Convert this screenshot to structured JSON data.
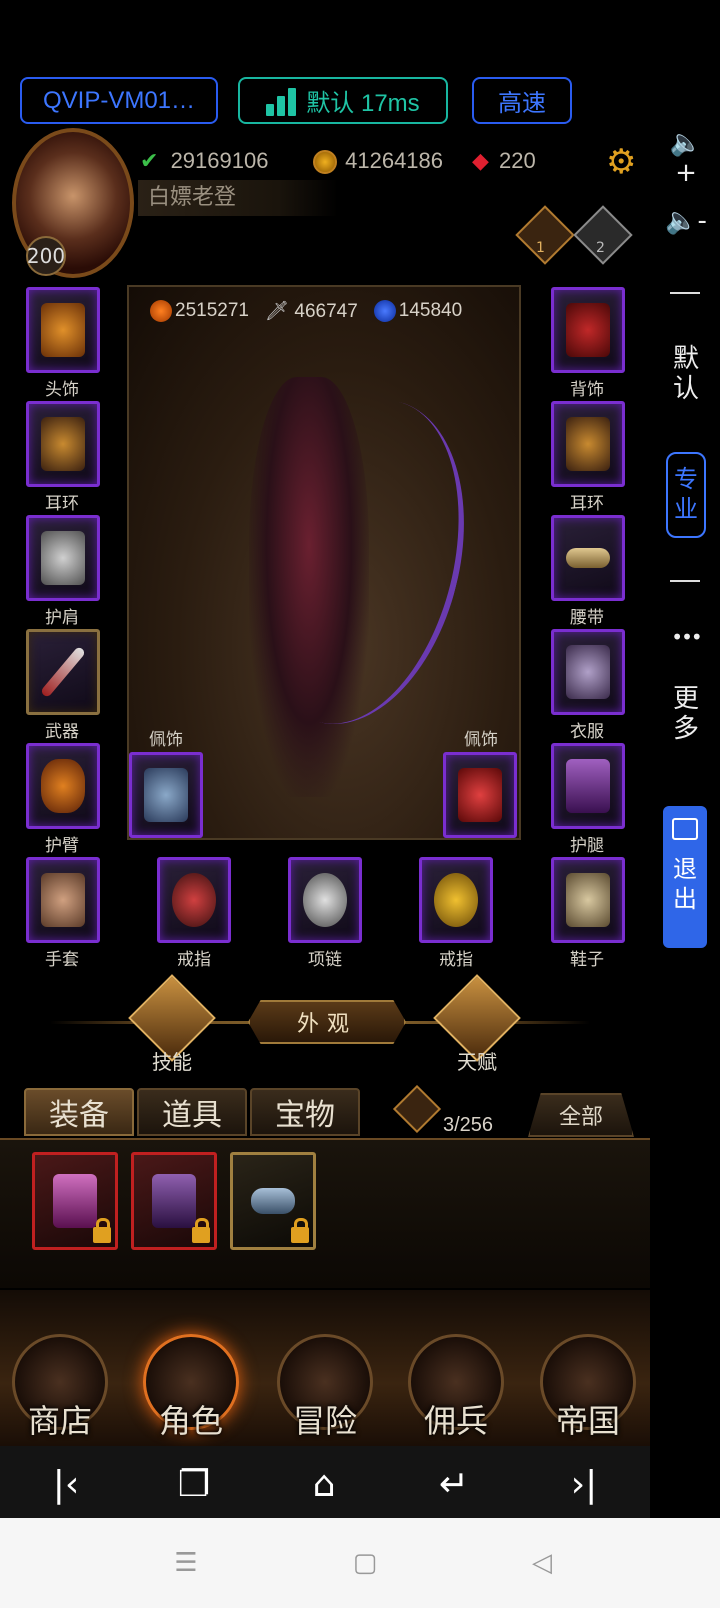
{
  "toolbar": {
    "vm_label": "QVIP-VM01…",
    "ping_label": "默认 17ms",
    "speed_label": "高速"
  },
  "side_panel": {
    "vol_up": "🔈+",
    "vol_down": "🔈-",
    "mode_default": "默认",
    "mode_pro": "专业",
    "more_dots": "•••",
    "more": "更多",
    "exit": "退出"
  },
  "player": {
    "level": "200",
    "name": "白嫖老登",
    "power": "29169106",
    "gold": "41264186",
    "gems": "220",
    "rank1": "1",
    "rank2": "2"
  },
  "resources": {
    "food": "2515271",
    "attack": "466747",
    "mana": "145840"
  },
  "equipment": {
    "head": "头饰",
    "ear_left": "耳环",
    "shoulder": "护肩",
    "weapon": "武器",
    "arm": "护臂",
    "gloves": "手套",
    "back": "背饰",
    "ear_right": "耳环",
    "belt": "腰带",
    "clothes": "衣服",
    "legs": "护腿",
    "shoes": "鞋子",
    "ring_left": "戒指",
    "necklace": "项链",
    "ring_right": "戒指",
    "accessory_left": "佩饰",
    "accessory_right": "佩饰"
  },
  "features": {
    "skills": "技能",
    "outfit": "外观",
    "talent": "天赋"
  },
  "inventory": {
    "tabs": [
      "装备",
      "道具",
      "宝物"
    ],
    "count": "3/256",
    "filter": "全部"
  },
  "nav": {
    "items": [
      "商店",
      "角色",
      "冒险",
      "佣兵",
      "帝国"
    ]
  },
  "colors": {
    "accent_blue": "#3d76ff",
    "accent_teal": "#1fc4a5",
    "epic_purple": "#7a2ed0",
    "rare_red": "#c02020"
  }
}
